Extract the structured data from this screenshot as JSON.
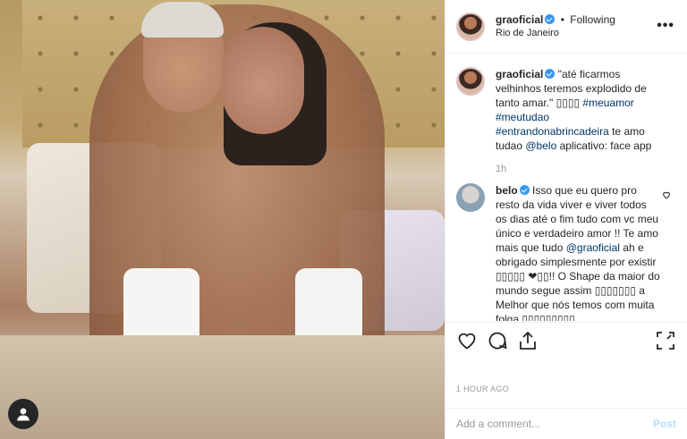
{
  "header": {
    "username": "graoficial",
    "separator": "•",
    "follow_state": "Following",
    "location": "Rio de Janeiro",
    "more_label": "•••"
  },
  "caption": {
    "username": "graoficial",
    "text_1": "\"até ficarmos velhinhos teremos explodido de tanto amar.\" ",
    "emoji_1": "▯▯▯▯",
    "hashtags": [
      "#meuamor",
      "#meutudao",
      "#entrandonabrincadeira"
    ],
    "text_2": " te amo tudao ",
    "mention": "@belo",
    "text_3": " aplicativo: face app",
    "time": "1h"
  },
  "comment": {
    "username": "belo",
    "text_1": "Isso que eu quero pro resto da vida viver e viver todos os dias até o fim tudo com vc meu único e verdadeiro amor !! Te amo mais que tudo ",
    "mention": "@graoficial",
    "text_2": " ah e obrigado simplesmente por existir ▯▯▯▯▯ ❤▯▯!! O Shape da maior do mundo segue assim ▯▯▯▯▯▯▯ a Melhor que nós temos com muita folga ▯▯▯▯▯▯▯▯▯"
  },
  "footer": {
    "timestamp": "1 HOUR AGO",
    "comment_placeholder": "Add a comment...",
    "post_label": "Post"
  },
  "colors": {
    "verified": "#3897f0",
    "link": "#003569",
    "post_disabled": "#b2dffc",
    "muted": "#999999"
  }
}
